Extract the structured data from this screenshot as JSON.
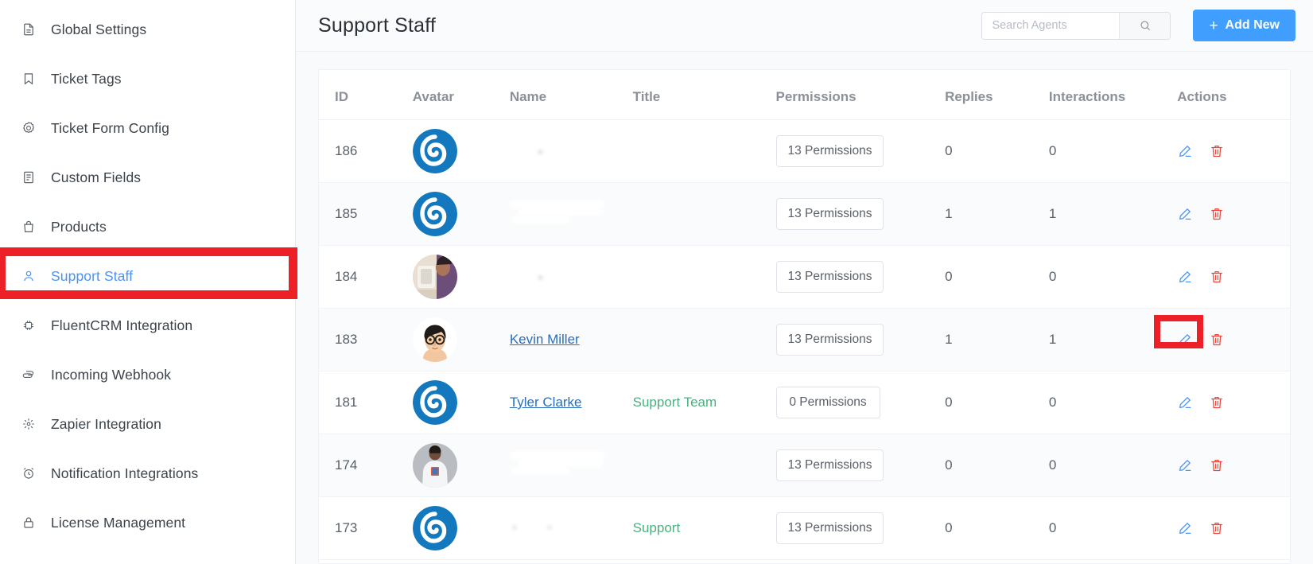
{
  "sidebar": {
    "items": [
      {
        "label": "Global Settings",
        "icon": "document-icon",
        "active": false
      },
      {
        "label": "Ticket Tags",
        "icon": "bookmark-icon",
        "active": false
      },
      {
        "label": "Ticket Form Config",
        "icon": "gear-outline-icon",
        "active": false
      },
      {
        "label": "Custom Fields",
        "icon": "list-document-icon",
        "active": false
      },
      {
        "label": "Products",
        "icon": "bag-icon",
        "active": false
      },
      {
        "label": "Support Staff",
        "icon": "user-icon",
        "active": true
      },
      {
        "label": "FluentCRM Integration",
        "icon": "chip-icon",
        "active": false
      },
      {
        "label": "Incoming Webhook",
        "icon": "webhook-icon",
        "active": false
      },
      {
        "label": "Zapier Integration",
        "icon": "sparkle-icon",
        "active": false
      },
      {
        "label": "Notification Integrations",
        "icon": "alarm-clock-icon",
        "active": false
      },
      {
        "label": "License Management",
        "icon": "lock-icon",
        "active": false
      }
    ]
  },
  "header": {
    "title": "Support Staff",
    "search": {
      "value": "",
      "placeholder": "Search Agents",
      "icon": "search-icon"
    },
    "add_button": {
      "label": "Add New",
      "plus": "+",
      "color": "#409eff"
    }
  },
  "table": {
    "columns": [
      "ID",
      "Avatar",
      "Name",
      "Title",
      "Permissions",
      "Replies",
      "Interactions",
      "Actions"
    ],
    "rows": [
      {
        "id": "186",
        "avatar": "default-logo-avatar",
        "name": "",
        "redacted": "dot",
        "title": "",
        "permissions": "13 Permissions",
        "replies": "0",
        "interactions": "0"
      },
      {
        "id": "185",
        "avatar": "default-logo-avatar",
        "name": "",
        "redacted": "block",
        "title": "",
        "permissions": "13 Permissions",
        "replies": "1",
        "interactions": "1"
      },
      {
        "id": "184",
        "avatar": "photo-avatar-1",
        "name": "",
        "redacted": "dot",
        "title": "",
        "permissions": "13 Permissions",
        "replies": "0",
        "interactions": "0"
      },
      {
        "id": "183",
        "avatar": "illustration-avatar",
        "name": "Kevin Miller",
        "redacted": "none",
        "title": "",
        "permissions": "13 Permissions",
        "replies": "1",
        "interactions": "1"
      },
      {
        "id": "181",
        "avatar": "default-logo-avatar",
        "name": "Tyler Clarke",
        "redacted": "none",
        "title": "Support Team",
        "permissions": "0 Permissions",
        "replies": "0",
        "interactions": "0"
      },
      {
        "id": "174",
        "avatar": "photo-avatar-2",
        "name": "",
        "redacted": "block",
        "title": "",
        "permissions": "13 Permissions",
        "replies": "0",
        "interactions": "0"
      },
      {
        "id": "173",
        "avatar": "default-logo-avatar",
        "name": "",
        "redacted": "dots",
        "title": "Support",
        "permissions": "13 Permissions",
        "replies": "0",
        "interactions": "0"
      }
    ],
    "action_icons": {
      "edit": "edit-pencil-icon",
      "delete": "trash-icon"
    }
  },
  "annotations": {
    "highlight_color": "#ee2027",
    "boxes": [
      {
        "target": "sidebar-item-support-staff"
      },
      {
        "target": "edit-button-row-183"
      }
    ]
  }
}
